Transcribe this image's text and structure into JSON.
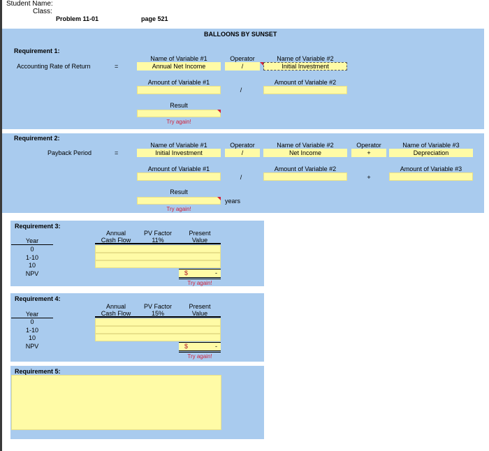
{
  "header": {
    "student_name_label": "Student Name:",
    "class_label": "Class:",
    "problem": "Problem 11-01",
    "page": "page 521"
  },
  "title": "BALLOONS BY SUNSET",
  "req1": {
    "heading": "Requirement 1:",
    "label": "Accounting Rate of Return",
    "equals": "=",
    "var1_header": "Name of Variable #1",
    "var1_value": "Annual Net Income",
    "operator_header": "Operator",
    "operator_value": "/",
    "var2_header": "Name of Variable #2",
    "var2_value": "Initial Investment",
    "amt1_header": "Amount of Variable #1",
    "amt_operator": "/",
    "amt2_header": "Amount of Variable #2",
    "result_label": "Result",
    "feedback": "Try again!"
  },
  "req2": {
    "heading": "Requirement 2:",
    "label": "Payback Period",
    "equals": "=",
    "var1_header": "Name of Variable #1",
    "var1_value": "Initial Investment",
    "operator1_header": "Operator",
    "operator1_value": "/",
    "var2_header": "Name of Variable #2",
    "var2_value": "Net Income",
    "operator2_header": "Operator",
    "operator2_value": "+",
    "var3_header": "Name of Variable #3",
    "var3_value": "Depreciation",
    "amt1_header": "Amount of Variable #1",
    "amt_op1": "/",
    "amt2_header": "Amount of Variable #2",
    "amt_op2": "+",
    "amt3_header": "Amount of Variable #3",
    "result_label": "Result",
    "result_unit": "years",
    "feedback": "Try again!"
  },
  "req3": {
    "heading": "Requirement 3:",
    "year_header": "Year",
    "col_cash_1": "Annual",
    "col_cash_2": "Cash Flow",
    "col_pv_1": "PV Factor",
    "col_pv_2": "11%",
    "col_present_1": "Present",
    "col_present_2": "Value",
    "rows": [
      "0",
      "1-10",
      "10",
      "NPV"
    ],
    "npv_currency": "$",
    "npv_value": "-",
    "feedback": "Try again!"
  },
  "req4": {
    "heading": "Requirement 4:",
    "year_header": "Year",
    "col_cash_1": "Annual",
    "col_cash_2": "Cash Flow",
    "col_pv_1": "PV Factor",
    "col_pv_2": "15%",
    "col_present_1": "Present",
    "col_present_2": "Value",
    "rows": [
      "0",
      "1-10",
      "10",
      "NPV"
    ],
    "npv_currency": "$",
    "npv_value": "-",
    "feedback": "Try again!"
  },
  "req5": {
    "heading": "Requirement 5:"
  },
  "colors": {
    "band": "#a9cbee",
    "input": "#fffba6",
    "error": "#d2213a"
  }
}
